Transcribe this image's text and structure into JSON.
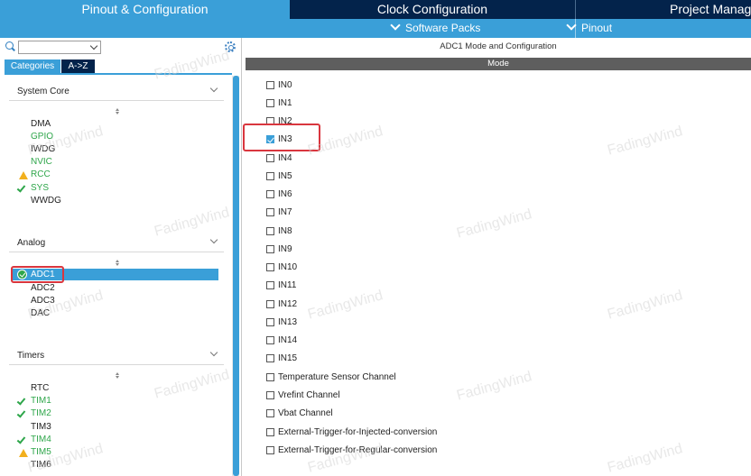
{
  "top_tabs": [
    {
      "label": "Pinout & Configuration",
      "active": true
    },
    {
      "label": "Clock Configuration",
      "active": false
    },
    {
      "label": "Project Manag",
      "active": false
    }
  ],
  "sub_nav": {
    "software_packs": "Software Packs",
    "pinout": "Pinout"
  },
  "left": {
    "tabs": {
      "categories": "Categories",
      "az": "A->Z"
    },
    "sections": {
      "system_core": {
        "title": "System Core",
        "items": [
          {
            "label": "DMA",
            "status": "none"
          },
          {
            "label": "GPIO",
            "status": "ok"
          },
          {
            "label": "IWDG",
            "status": "none"
          },
          {
            "label": "NVIC",
            "status": "ok"
          },
          {
            "label": "RCC",
            "status": "warning"
          },
          {
            "label": "SYS",
            "status": "ok"
          },
          {
            "label": "WWDG",
            "status": "none"
          }
        ]
      },
      "analog": {
        "title": "Analog",
        "items": [
          {
            "label": "ADC1",
            "status": "selected"
          },
          {
            "label": "ADC2",
            "status": "none"
          },
          {
            "label": "ADC3",
            "status": "none"
          },
          {
            "label": "DAC",
            "status": "none"
          }
        ]
      },
      "timers": {
        "title": "Timers",
        "items": [
          {
            "label": "RTC",
            "status": "none"
          },
          {
            "label": "TIM1",
            "status": "ok"
          },
          {
            "label": "TIM2",
            "status": "ok"
          },
          {
            "label": "TIM3",
            "status": "none"
          },
          {
            "label": "TIM4",
            "status": "ok"
          },
          {
            "label": "TIM5",
            "status": "warning"
          },
          {
            "label": "TIM6",
            "status": "none"
          }
        ]
      }
    }
  },
  "right": {
    "title": "ADC1 Mode and Configuration",
    "mode_header": "Mode",
    "channels": [
      {
        "label": "IN0",
        "checked": false
      },
      {
        "label": "IN1",
        "checked": false
      },
      {
        "label": "IN2",
        "checked": false
      },
      {
        "label": "IN3",
        "checked": true
      },
      {
        "label": "IN4",
        "checked": false
      },
      {
        "label": "IN5",
        "checked": false
      },
      {
        "label": "IN6",
        "checked": false
      },
      {
        "label": "IN7",
        "checked": false
      },
      {
        "label": "IN8",
        "checked": false
      },
      {
        "label": "IN9",
        "checked": false
      },
      {
        "label": "IN10",
        "checked": false
      },
      {
        "label": "IN11",
        "checked": false
      },
      {
        "label": "IN12",
        "checked": false
      },
      {
        "label": "IN13",
        "checked": false
      },
      {
        "label": "IN14",
        "checked": false
      },
      {
        "label": "IN15",
        "checked": false
      },
      {
        "label": "Temperature Sensor Channel",
        "checked": false
      },
      {
        "label": "Vrefint Channel",
        "checked": false
      },
      {
        "label": "Vbat Channel",
        "checked": false
      },
      {
        "label": "External-Trigger-for-Injected-conversion",
        "checked": false
      },
      {
        "label": "External-Trigger-for-Regular-conversion",
        "checked": false
      }
    ]
  },
  "watermark": "FadingWind",
  "colors": {
    "dark_navy": "#03234b",
    "accent_blue": "#3a9fd8",
    "ok_green": "#2ea64a",
    "warning_yellow": "#f2b01e",
    "highlight_red": "#d9363e"
  }
}
